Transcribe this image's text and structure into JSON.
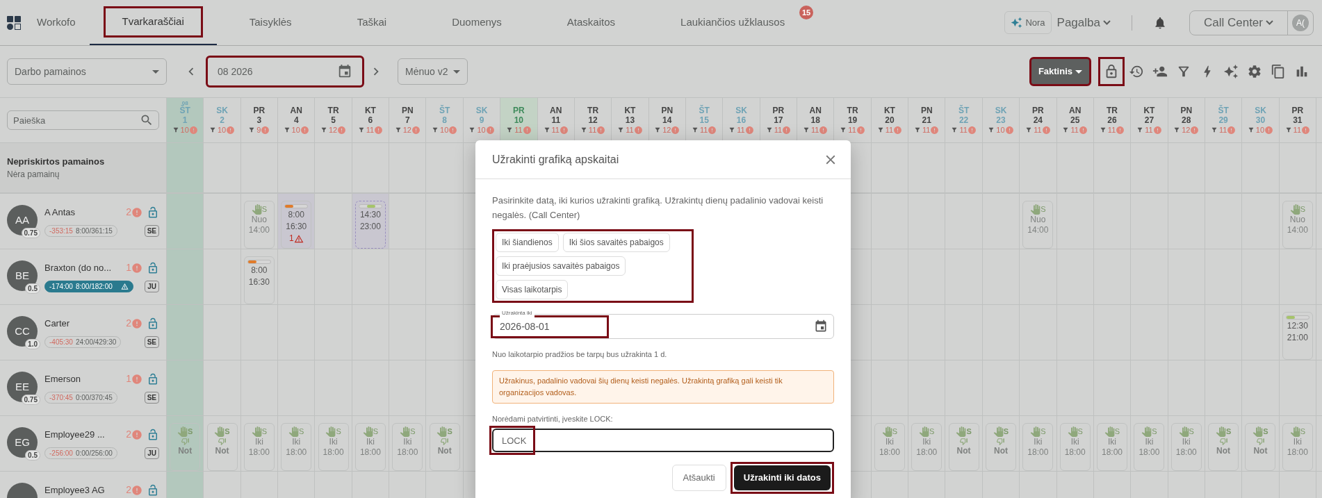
{
  "nav": {
    "brand": "Workofo",
    "tabs": [
      {
        "label": "Tvarkaraščiai",
        "selected": true,
        "highlighted": true
      },
      {
        "label": "Taisyklės",
        "selected": false,
        "highlighted": false
      },
      {
        "label": "Taškai",
        "selected": false,
        "highlighted": false
      },
      {
        "label": "Duomenys",
        "selected": false,
        "highlighted": false
      },
      {
        "label": "Ataskaitos",
        "selected": false,
        "highlighted": false
      },
      {
        "label": "Laukiančios užklausos",
        "selected": false,
        "highlighted": false,
        "badge": "15"
      }
    ],
    "assistant": "Nora",
    "help": "Pagalba",
    "unit": "Call Center",
    "avatar": "A("
  },
  "toolbar": {
    "view_select": "Darbo pamainos",
    "period": {
      "value": "08 2026",
      "highlighted": true
    },
    "layout_select": "Mėnuo v2",
    "mode": {
      "label": "Faktinis",
      "highlighted": true
    },
    "lock_highlighted": true
  },
  "search": {
    "placeholder": "Paieška"
  },
  "days": [
    {
      "weekday": "ŠT",
      "day": "1",
      "count": "10",
      "weekend": true,
      "highlighted": true,
      "today": false,
      "month": "08"
    },
    {
      "weekday": "SK",
      "day": "2",
      "count": "10",
      "weekend": true,
      "highlighted": false,
      "today": false
    },
    {
      "weekday": "PR",
      "day": "3",
      "count": "9",
      "weekend": false,
      "highlighted": false,
      "today": false
    },
    {
      "weekday": "AN",
      "day": "4",
      "count": "10",
      "weekend": false,
      "highlighted": false,
      "today": false
    },
    {
      "weekday": "TR",
      "day": "5",
      "count": "12",
      "weekend": false,
      "highlighted": false,
      "today": false
    },
    {
      "weekday": "KT",
      "day": "6",
      "count": "11",
      "weekend": false,
      "highlighted": false,
      "today": false
    },
    {
      "weekday": "PN",
      "day": "7",
      "count": "12",
      "weekend": false,
      "highlighted": false,
      "today": false
    },
    {
      "weekday": "ŠT",
      "day": "8",
      "count": "10",
      "weekend": true,
      "highlighted": false,
      "today": false
    },
    {
      "weekday": "SK",
      "day": "9",
      "count": "10",
      "weekend": true,
      "highlighted": false,
      "today": false
    },
    {
      "weekday": "PR",
      "day": "10",
      "count": "11",
      "weekend": false,
      "highlighted": false,
      "today": true
    },
    {
      "weekday": "AN",
      "day": "11",
      "count": "11",
      "weekend": false,
      "highlighted": false,
      "today": false
    },
    {
      "weekday": "TR",
      "day": "12",
      "count": "11",
      "weekend": false,
      "highlighted": false,
      "today": false
    },
    {
      "weekday": "KT",
      "day": "13",
      "count": "11",
      "weekend": false,
      "highlighted": false,
      "today": false
    },
    {
      "weekday": "PN",
      "day": "14",
      "count": "12",
      "weekend": false,
      "highlighted": false,
      "today": false
    },
    {
      "weekday": "ŠT",
      "day": "15",
      "count": "11",
      "weekend": true,
      "highlighted": false,
      "today": false
    },
    {
      "weekday": "SK",
      "day": "16",
      "count": "11",
      "weekend": true,
      "highlighted": false,
      "today": false
    },
    {
      "weekday": "PR",
      "day": "17",
      "count": "11",
      "weekend": false,
      "highlighted": false,
      "today": false
    },
    {
      "weekday": "AN",
      "day": "18",
      "count": "11",
      "weekend": false,
      "highlighted": false,
      "today": false
    },
    {
      "weekday": "TR",
      "day": "19",
      "count": "11",
      "weekend": false,
      "highlighted": false,
      "today": false
    },
    {
      "weekday": "KT",
      "day": "20",
      "count": "11",
      "weekend": false,
      "highlighted": false,
      "today": false
    },
    {
      "weekday": "PN",
      "day": "21",
      "count": "11",
      "weekend": false,
      "highlighted": false,
      "today": false
    },
    {
      "weekday": "ŠT",
      "day": "22",
      "count": "11",
      "weekend": true,
      "highlighted": false,
      "today": false
    },
    {
      "weekday": "SK",
      "day": "23",
      "count": "10",
      "weekend": true,
      "highlighted": false,
      "today": false
    },
    {
      "weekday": "PR",
      "day": "24",
      "count": "11",
      "weekend": false,
      "highlighted": false,
      "today": false
    },
    {
      "weekday": "AN",
      "day": "25",
      "count": "11",
      "weekend": false,
      "highlighted": false,
      "today": false
    },
    {
      "weekday": "TR",
      "day": "26",
      "count": "11",
      "weekend": false,
      "highlighted": false,
      "today": false
    },
    {
      "weekday": "KT",
      "day": "27",
      "count": "11",
      "weekend": false,
      "highlighted": false,
      "today": false
    },
    {
      "weekday": "PN",
      "day": "28",
      "count": "12",
      "weekend": false,
      "highlighted": false,
      "today": false
    },
    {
      "weekday": "ŠT",
      "day": "29",
      "count": "11",
      "weekend": true,
      "highlighted": false,
      "today": false
    },
    {
      "weekday": "SK",
      "day": "30",
      "count": "10",
      "weekend": true,
      "highlighted": false,
      "today": false
    },
    {
      "weekday": "PR",
      "day": "31",
      "count": "11",
      "weekend": false,
      "highlighted": false,
      "today": false
    }
  ],
  "unassigned": {
    "title": "Nepriskirtos pamainos",
    "subtitle": "Nėra pamainų"
  },
  "employees": [
    {
      "initials": "AA",
      "fte": "0.75",
      "name": "A Antas",
      "count": "2",
      "balance": "-353:15",
      "hours": "8:00/361:15",
      "alert": false,
      "tag": "SE",
      "cells": [
        {
          "kind": "empty"
        },
        {
          "kind": "empty"
        },
        {
          "kind": "request",
          "tag": "S",
          "lines": [
            "Nuo",
            "14:00"
          ]
        },
        {
          "kind": "shift",
          "start": "8:00",
          "end": "16:30",
          "color": "#e07b2a",
          "warnings": "1",
          "tentative": false,
          "marked": true
        },
        {
          "kind": "empty"
        },
        {
          "kind": "shift",
          "start": "14:30",
          "end": "23:00",
          "color": "#a6c46a",
          "tentative": true,
          "marked": true
        },
        {
          "kind": "empty"
        },
        {
          "kind": "empty"
        },
        {
          "kind": "empty"
        },
        {
          "kind": "empty"
        },
        {
          "kind": "empty"
        },
        {
          "kind": "empty"
        },
        {
          "kind": "empty"
        },
        {
          "kind": "empty"
        },
        {
          "kind": "empty"
        },
        {
          "kind": "empty"
        },
        {
          "kind": "empty"
        },
        {
          "kind": "empty"
        },
        {
          "kind": "empty"
        },
        {
          "kind": "empty"
        },
        {
          "kind": "empty"
        },
        {
          "kind": "empty"
        },
        {
          "kind": "empty"
        },
        {
          "kind": "request",
          "tag": "S",
          "lines": [
            "Nuo",
            "14:00"
          ]
        },
        {
          "kind": "empty"
        },
        {
          "kind": "empty"
        },
        {
          "kind": "empty"
        },
        {
          "kind": "empty"
        },
        {
          "kind": "empty"
        },
        {
          "kind": "empty"
        },
        {
          "kind": "request",
          "tag": "S",
          "lines": [
            "Nuo",
            "14:00"
          ]
        }
      ]
    },
    {
      "initials": "BE",
      "fte": "0.5",
      "name": "Braxton (do no...",
      "count": "1",
      "balance": "-174:00",
      "hours": "8:00/182:00",
      "alert": true,
      "tag": "JU",
      "cells": [
        {
          "kind": "empty"
        },
        {
          "kind": "empty"
        },
        {
          "kind": "shift",
          "start": "8:00",
          "end": "16:30",
          "color": "#e07b2a",
          "tentative": false,
          "marked": false
        }
      ]
    },
    {
      "initials": "CC",
      "fte": "1.0",
      "name": "Carter",
      "count": "2",
      "balance": "-405:30",
      "hours": "24:00/429:30",
      "alert": false,
      "tag": "SE",
      "cells": [
        {
          "kind": "empty"
        },
        {
          "kind": "empty"
        },
        {
          "kind": "empty"
        },
        {
          "kind": "empty"
        },
        {
          "kind": "empty"
        },
        {
          "kind": "empty"
        },
        {
          "kind": "empty"
        },
        {
          "kind": "empty"
        },
        {
          "kind": "empty"
        },
        {
          "kind": "empty"
        },
        {
          "kind": "empty"
        },
        {
          "kind": "empty"
        },
        {
          "kind": "empty"
        },
        {
          "kind": "empty"
        },
        {
          "kind": "empty"
        },
        {
          "kind": "empty"
        },
        {
          "kind": "empty"
        },
        {
          "kind": "empty"
        },
        {
          "kind": "empty"
        },
        {
          "kind": "empty"
        },
        {
          "kind": "empty"
        },
        {
          "kind": "empty"
        },
        {
          "kind": "empty"
        },
        {
          "kind": "empty"
        },
        {
          "kind": "empty"
        },
        {
          "kind": "empty"
        },
        {
          "kind": "empty"
        },
        {
          "kind": "empty"
        },
        {
          "kind": "empty"
        },
        {
          "kind": "empty"
        },
        {
          "kind": "shift",
          "start": "12:30",
          "end": "21:00",
          "color": "#a6c46a",
          "tentative": false,
          "marked": false
        }
      ]
    },
    {
      "initials": "EE",
      "fte": "0.75",
      "name": "Emerson",
      "count": "1",
      "balance": "-370:45",
      "hours": "0:00/370:45",
      "alert": false,
      "tag": "SE"
    },
    {
      "initials": "EG",
      "fte": "0.5",
      "name": "Employee29 ...",
      "count": "2",
      "balance": "-256:00",
      "hours": "0:00/256:00",
      "alert": false,
      "tag": "JU",
      "cells": [
        {
          "kind": "declined",
          "tag": "S",
          "label": "Not"
        },
        {
          "kind": "declined",
          "tag": "S",
          "label": "Not"
        },
        {
          "kind": "request",
          "tag": "S",
          "lines": [
            "Iki",
            "18:00"
          ]
        },
        {
          "kind": "request",
          "tag": "S",
          "lines": [
            "Iki",
            "18:00"
          ]
        },
        {
          "kind": "request",
          "tag": "S",
          "lines": [
            "Iki",
            "18:00"
          ]
        },
        {
          "kind": "request",
          "tag": "S",
          "lines": [
            "Iki",
            "18:00"
          ]
        },
        {
          "kind": "request",
          "tag": "S",
          "lines": [
            "Iki",
            "18:00"
          ]
        },
        {
          "kind": "declined",
          "tag": "S",
          "label": "Not"
        },
        {
          "kind": "empty"
        },
        {
          "kind": "empty"
        },
        {
          "kind": "empty"
        },
        {
          "kind": "empty"
        },
        {
          "kind": "empty"
        },
        {
          "kind": "empty"
        },
        {
          "kind": "empty"
        },
        {
          "kind": "empty"
        },
        {
          "kind": "empty"
        },
        {
          "kind": "empty"
        },
        {
          "kind": "empty"
        },
        {
          "kind": "request",
          "tag": "S",
          "lines": [
            "Iki",
            "18:00"
          ]
        },
        {
          "kind": "request",
          "tag": "S",
          "lines": [
            "Iki",
            "18:00"
          ]
        },
        {
          "kind": "declined",
          "tag": "S",
          "label": "Not"
        },
        {
          "kind": "declined",
          "tag": "S",
          "label": "Not"
        },
        {
          "kind": "request",
          "tag": "S",
          "lines": [
            "Iki",
            "18:00"
          ]
        },
        {
          "kind": "request",
          "tag": "S",
          "lines": [
            "Iki",
            "18:00"
          ]
        },
        {
          "kind": "request",
          "tag": "S",
          "lines": [
            "Iki",
            "18:00"
          ]
        },
        {
          "kind": "request",
          "tag": "S",
          "lines": [
            "Iki",
            "18:00"
          ]
        },
        {
          "kind": "request",
          "tag": "S",
          "lines": [
            "Iki",
            "18:00"
          ]
        },
        {
          "kind": "declined",
          "tag": "S",
          "label": "Not"
        },
        {
          "kind": "declined",
          "tag": "S",
          "label": "Not"
        },
        {
          "kind": "request",
          "tag": "S",
          "lines": [
            "Iki",
            "18:00"
          ]
        }
      ]
    },
    {
      "name": "Employee3 AG",
      "count": "2"
    }
  ],
  "dialog": {
    "title": "Užrakinti grafiką apskaitai",
    "description": "Pasirinkite datą, iki kurios užrakinti grafiką. Užrakintų dienų padalinio vadovai keisti negalės. (Call Center)",
    "presets": [
      "Iki šiandienos",
      "Iki šios savaitės pabaigos",
      "Iki praėjusios savaitės pabaigos",
      "Visas laikotarpis"
    ],
    "presets_highlighted": true,
    "date_field": {
      "label": "Užrakinta iki",
      "value": "2026-08-01",
      "highlighted": true
    },
    "hint": "Nuo laikotarpio pradžios be tarpų bus užrakinta 1 d.",
    "warning": "Užrakinus, padalinio vadovai šių dienų keisti negalės. Užrakintą grafiką gali keisti tik organizacijos vadovas.",
    "confirm_label": "Norėdami patvirtinti, įveskite LOCK:",
    "confirm_field": {
      "value": "LOCK",
      "highlighted": true
    },
    "cancel": "Atšaukti",
    "submit": {
      "label": "Užrakinti iki datos",
      "highlighted": true
    }
  }
}
